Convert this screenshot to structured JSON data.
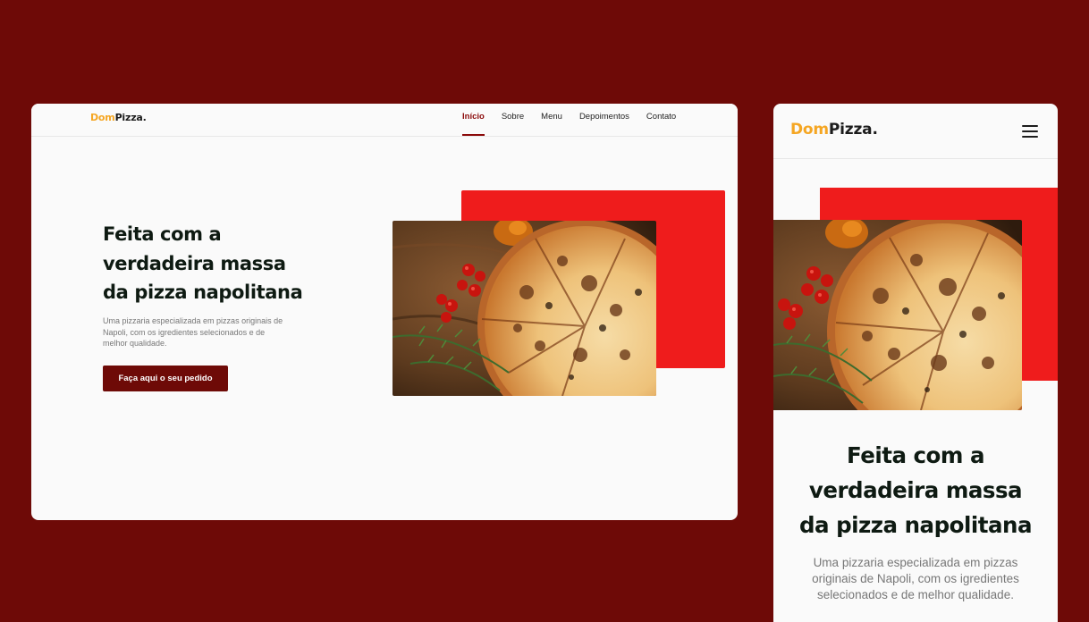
{
  "brand": {
    "logo_part1": "Dom",
    "logo_part2": "Pizza."
  },
  "nav": {
    "items": [
      {
        "label": "Início",
        "active": true
      },
      {
        "label": "Sobre",
        "active": false
      },
      {
        "label": "Menu",
        "active": false
      },
      {
        "label": "Depoimentos",
        "active": false
      },
      {
        "label": "Contato",
        "active": false
      }
    ]
  },
  "hero": {
    "title_line1": "Feita com a",
    "title_line2": "verdadeira massa",
    "title_line3": "da pizza napolitana",
    "mobile_title_line1": "Feita com a",
    "mobile_title_line2": "verdadeira massa",
    "mobile_title_line3": "da pizza napolitana",
    "description_line1": "Uma pizzaria especializada em pizzas originais de",
    "description_line2": "Napoli, com os igredientes selecionados e de",
    "description_line3": "melhor qualidade.",
    "mobile_description_line1": "Uma pizzaria especializada em pizzas",
    "mobile_description_line2": "originais de Napoli, com os igredientes",
    "mobile_description_line3": "selecionados e de melhor qualidade.",
    "cta_label": "Faça aqui o seu pedido",
    "image": "pizza-photo"
  },
  "mobile": {
    "menu_icon": "hamburger-menu-icon"
  },
  "colors": {
    "background": "#6e0a07",
    "accent_red": "#ef1c1c",
    "button": "#6e0a07",
    "logo_yellow": "#f5a623",
    "nav_active": "#8b0a0a",
    "heading": "#0e1a12"
  }
}
